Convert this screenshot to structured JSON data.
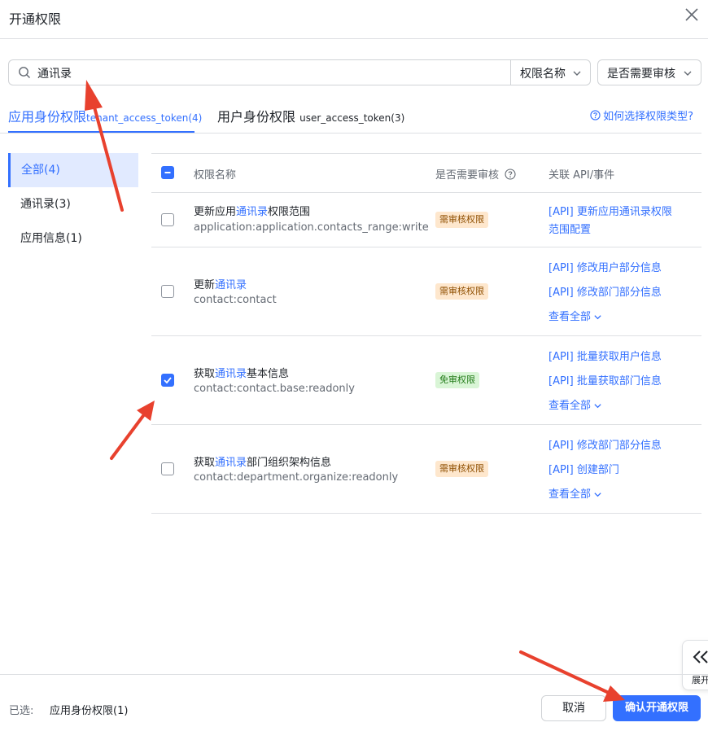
{
  "dialog": {
    "title": "开通权限"
  },
  "search": {
    "value": "通讯录",
    "icon": "search-icon"
  },
  "filters": [
    {
      "label": "权限名称"
    },
    {
      "label": "是否需要审核"
    }
  ],
  "tabs": [
    {
      "label": "应用身份权限",
      "token": "tenant_access_token(4)"
    },
    {
      "label": "用户身份权限",
      "token": "user_access_token(3)"
    }
  ],
  "help_link": "如何选择权限类型?",
  "categories": [
    {
      "label": "全部(4)"
    },
    {
      "label": "通讯录(3)"
    },
    {
      "label": "应用信息(1)"
    }
  ],
  "table": {
    "headers": {
      "name": "权限名称",
      "review": "是否需要审核",
      "api": "关联 API/事件"
    },
    "rows": [
      {
        "name_pre": "更新应用",
        "name_hl": "通讯录",
        "name_post": "权限范围",
        "code": "application:application.contacts_range:write",
        "badge": "需审核权限",
        "checked": false,
        "apis": [
          "[API] 更新应用通讯录权限",
          "范围配置"
        ],
        "more": ""
      },
      {
        "name_pre": "更新",
        "name_hl": "通讯录",
        "name_post": "",
        "code": "contact:contact",
        "badge": "需审核权限",
        "checked": false,
        "apis": [
          "[API] 修改用户部分信息",
          "[API] 修改部门部分信息"
        ],
        "more": "查看全部"
      },
      {
        "name_pre": "获取",
        "name_hl": "通讯录",
        "name_post": "基本信息",
        "code": "contact:contact.base:readonly",
        "badge": "免审权限",
        "checked": true,
        "apis": [
          "[API] 批量获取用户信息",
          "[API] 批量获取部门信息"
        ],
        "more": "查看全部"
      },
      {
        "name_pre": "获取",
        "name_hl": "通讯录",
        "name_post": "部门组织架构信息",
        "code": "contact:department.organize:readonly",
        "badge": "需审核权限",
        "checked": false,
        "apis": [
          "[API] 修改部门部分信息",
          "[API] 创建部门"
        ],
        "more": "查看全部"
      }
    ]
  },
  "expand_panel": {
    "label": "展开"
  },
  "footer": {
    "selected_label": "已选:",
    "selected_value": "应用身份权限(1)",
    "cancel": "取消",
    "confirm": "确认开通权限"
  },
  "colors": {
    "accent": "#3370ff",
    "annotation": "#e8412e",
    "badge_need_bg": "#fee7cd",
    "badge_free_bg": "#d9f5d6"
  }
}
